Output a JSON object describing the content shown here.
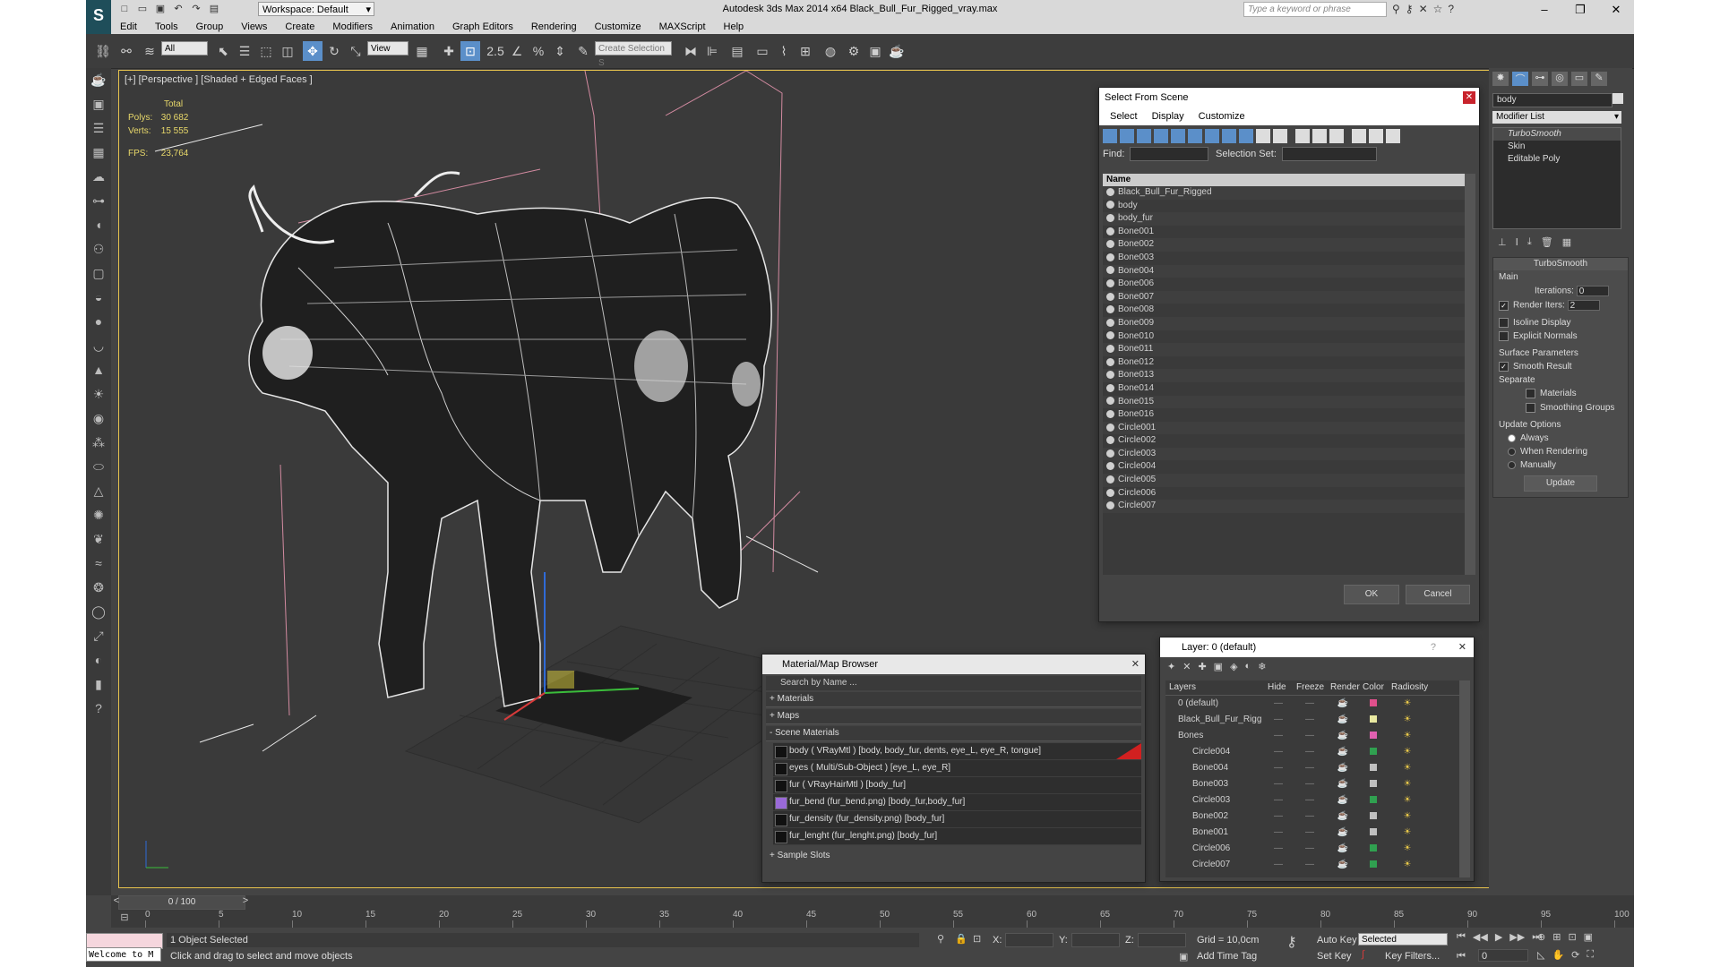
{
  "titlebar": {
    "workspace_label": "Workspace: Default",
    "app_title": "Autodesk 3ds Max  2014 x64     Black_Bull_Fur_Rigged_vray.max",
    "search_placeholder": "Type a keyword or phrase"
  },
  "menu": [
    "Edit",
    "Tools",
    "Group",
    "Views",
    "Create",
    "Modifiers",
    "Animation",
    "Graph Editors",
    "Rendering",
    "Customize",
    "MAXScript",
    "Help"
  ],
  "toolbar": {
    "filter_value": "All",
    "refcoord_value": "View",
    "snap_label": "2.5",
    "named_selection_placeholder": "Create Selection S"
  },
  "viewport": {
    "label": "[+] [Perspective ] [Shaded + Edged Faces ]",
    "stats_total": "Total",
    "polys_label": "Polys:",
    "polys_value": "30 682",
    "verts_label": "Verts:",
    "verts_value": "15 555",
    "fps_label": "FPS:",
    "fps_value": "23,764",
    "accent_color": "#e7c34d"
  },
  "select_from_scene": {
    "title": "Select From Scene",
    "tabs": [
      "Select",
      "Display",
      "Customize"
    ],
    "find_label": "Find:",
    "selection_set_label": "Selection Set:",
    "column_name": "Name",
    "items": [
      "Black_Bull_Fur_Rigged",
      "body",
      "body_fur",
      "Bone001",
      "Bone002",
      "Bone003",
      "Bone004",
      "Bone006",
      "Bone007",
      "Bone008",
      "Bone009",
      "Bone010",
      "Bone011",
      "Bone012",
      "Bone013",
      "Bone014",
      "Bone015",
      "Bone016",
      "Circle001",
      "Circle002",
      "Circle003",
      "Circle004",
      "Circle005",
      "Circle006",
      "Circle007"
    ],
    "ok_label": "OK",
    "cancel_label": "Cancel"
  },
  "material_browser": {
    "title": "Material/Map Browser",
    "search_placeholder": "Search by Name ...",
    "groups": [
      "+ Materials",
      "+ Maps",
      "- Scene Materials"
    ],
    "materials": [
      "body  ( VRayMtl ) [body, body_fur, dents, eye_L, eye_R, tongue]",
      "eyes  ( Multi/Sub-Object ) [eye_L, eye_R]",
      "fur  ( VRayHairMtl ) [body_fur]",
      "fur_bend (fur_bend.png) [body_fur,body_fur]",
      "fur_density (fur_density.png) [body_fur]",
      "fur_lenght (fur_lenght.png) [body_fur]"
    ],
    "sample_slots": "+ Sample Slots"
  },
  "layer_manager": {
    "title": "Layer: 0 (default)",
    "columns": [
      "Layers",
      "Hide",
      "Freeze",
      "Render",
      "Color",
      "Radiosity"
    ],
    "rows": [
      {
        "name": "0 (default)",
        "color": "#e0508c"
      },
      {
        "name": "Black_Bull_Fur_Rigg",
        "color": "#e8e8a0"
      },
      {
        "name": "Bones",
        "color": "#e060b0"
      },
      {
        "name": "Circle004",
        "color": "#30a050"
      },
      {
        "name": "Bone004",
        "color": "#c0c0c0"
      },
      {
        "name": "Bone003",
        "color": "#c0c0c0"
      },
      {
        "name": "Circle003",
        "color": "#30a050"
      },
      {
        "name": "Bone002",
        "color": "#c0c0c0"
      },
      {
        "name": "Bone001",
        "color": "#c0c0c0"
      },
      {
        "name": "Circle006",
        "color": "#30a050"
      },
      {
        "name": "Circle007",
        "color": "#30a050"
      }
    ]
  },
  "command_panel": {
    "object_name": "body",
    "modifier_list": "Modifier List",
    "stack": [
      "TurboSmooth",
      "Skin",
      "Editable Poly"
    ],
    "rollout_title": "TurboSmooth",
    "main_label": "Main",
    "iterations_label": "Iterations:",
    "iterations_value": "0",
    "render_iters_label": "Render Iters:",
    "render_iters_value": "2",
    "isoline_label": "Isoline Display",
    "explicit_normals_label": "Explicit Normals",
    "surface_params_label": "Surface Parameters",
    "smooth_result_label": "Smooth Result",
    "separate_label": "Separate",
    "materials_label": "Materials",
    "smoothing_groups_label": "Smoothing Groups",
    "update_options_label": "Update Options",
    "always_label": "Always",
    "when_rendering_label": "When Rendering",
    "manually_label": "Manually",
    "update_button": "Update"
  },
  "timeline": {
    "frame_counter": "0 / 100",
    "ticks": [
      "0",
      "5",
      "10",
      "15",
      "20",
      "25",
      "30",
      "35",
      "40",
      "45",
      "50",
      "55",
      "60",
      "65",
      "70",
      "75",
      "80",
      "85",
      "90",
      "95",
      "100"
    ]
  },
  "status": {
    "welcome": "Welcome to M",
    "selected": "1 Object Selected",
    "prompt": "Click and drag to select and move objects",
    "x_label": "X:",
    "y_label": "Y:",
    "z_label": "Z:",
    "grid": "Grid = 10,0cm",
    "auto_key": "Auto Key",
    "set_key": "Set Key",
    "key_mode": "Selected",
    "key_filters": "Key Filters...",
    "add_time_tag": "Add Time Tag",
    "frame_value": "0"
  }
}
